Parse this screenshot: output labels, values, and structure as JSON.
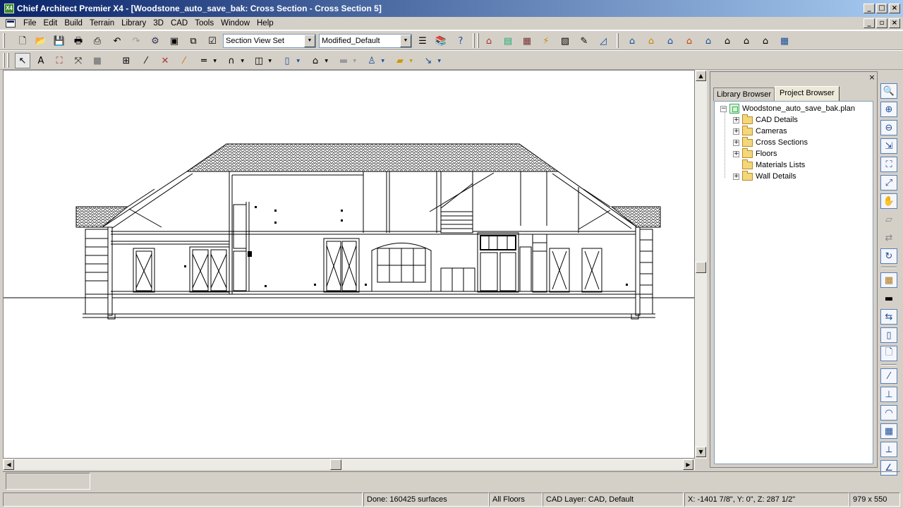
{
  "window": {
    "title": "Chief Architect Premier X4 - [Woodstone_auto_save_bak: Cross Section - Cross Section 5]",
    "app_icon_text": "X4"
  },
  "menu": [
    "File",
    "Edit",
    "Build",
    "Terrain",
    "Library",
    "3D",
    "CAD",
    "Tools",
    "Window",
    "Help"
  ],
  "toolbar1": {
    "view_set": "Section View Set",
    "layer_set": "Modified_Default"
  },
  "panel": {
    "tabs": [
      "Library Browser",
      "Project Browser"
    ],
    "active_tab": "Project Browser",
    "root": "Woodstone_auto_save_bak.plan",
    "items": [
      {
        "label": "CAD Details",
        "expandable": true
      },
      {
        "label": "Cameras",
        "expandable": true
      },
      {
        "label": "Cross Sections",
        "expandable": true
      },
      {
        "label": "Floors",
        "expandable": true
      },
      {
        "label": "Materials Lists",
        "expandable": false
      },
      {
        "label": "Wall Details",
        "expandable": true
      }
    ]
  },
  "status": {
    "message": "Done:  160425 surfaces",
    "floors": "All Floors",
    "cad_layer": "CAD Layer: CAD,  Default",
    "coords": "X: -1401 7/8\", Y: 0\", Z: 287 1/2\"",
    "size": "979 x 550"
  },
  "colors": {
    "titlebar_start": "#0a246a",
    "titlebar_end": "#a6caf0",
    "chrome": "#d4d0c8"
  }
}
